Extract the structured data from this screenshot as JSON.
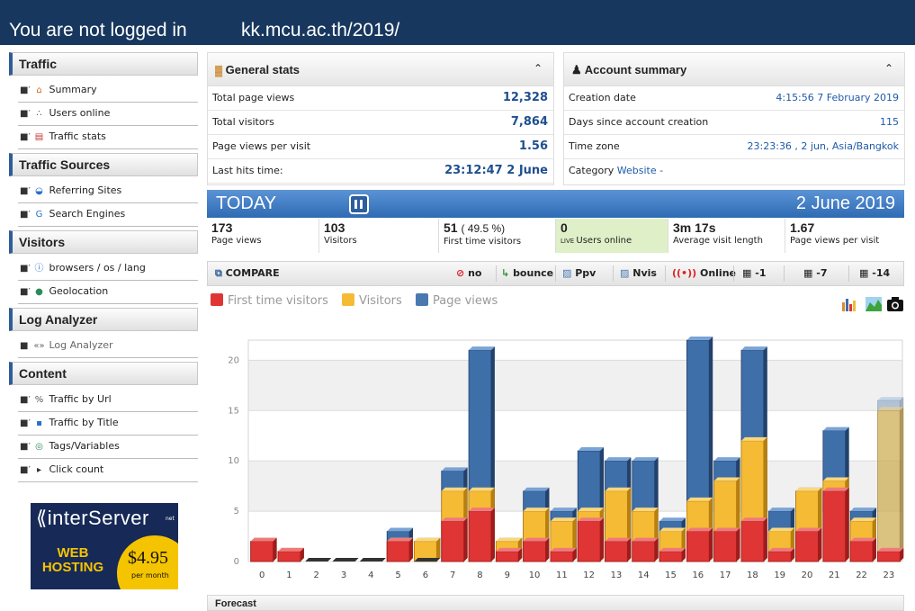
{
  "header": {
    "login_status": "You are not logged in",
    "site": "kk.mcu.ac.th/2019/"
  },
  "sidebar": {
    "sections": [
      {
        "title": "Traffic",
        "items": [
          {
            "label": "Summary",
            "icon": "home-icon",
            "locked": false
          },
          {
            "label": "Users online",
            "icon": "live-icon",
            "locked": false
          },
          {
            "label": "Traffic stats",
            "icon": "calendar-icon",
            "locked": false
          }
        ]
      },
      {
        "title": "Traffic Sources",
        "items": [
          {
            "label": "Referring Sites",
            "icon": "globe-icon",
            "locked": false
          },
          {
            "label": "Search Engines",
            "icon": "google-icon",
            "locked": false
          }
        ]
      },
      {
        "title": "Visitors",
        "items": [
          {
            "label": "browsers / os / lang",
            "icon": "info-icon",
            "locked": false
          },
          {
            "label": "Geolocation",
            "icon": "earth-icon",
            "locked": false
          }
        ]
      },
      {
        "title": "Log Analyzer",
        "items": [
          {
            "label": "Log Analyzer",
            "icon": "code-icon",
            "locked": true
          }
        ]
      },
      {
        "title": "Content",
        "items": [
          {
            "label": "Traffic by Url",
            "icon": "link-icon",
            "locked": false
          },
          {
            "label": "Traffic by Title",
            "icon": "title-icon",
            "locked": false
          },
          {
            "label": "Tags/Variables",
            "icon": "tag-icon",
            "locked": false
          },
          {
            "label": "Click count",
            "icon": "cursor-icon",
            "locked": false
          }
        ]
      }
    ]
  },
  "ad": {
    "brand": "interServer",
    "brand_suffix": "net",
    "line1": "WEB",
    "line2": "HOSTING",
    "price": "$4.95",
    "period": "per month"
  },
  "general_stats": {
    "title": "General stats",
    "rows": [
      {
        "label": "Total page views",
        "value": "12,328"
      },
      {
        "label": "Total visitors",
        "value": "7,864"
      },
      {
        "label": "Page views per visit",
        "value": "1.56"
      },
      {
        "label": "Last hits time:",
        "value": "23:12:47 2 June"
      }
    ]
  },
  "account_summary": {
    "title": "Account summary",
    "rows": [
      {
        "label": "Creation date",
        "value": "4:15:56 7 February 2019"
      },
      {
        "label": "Days since account creation",
        "value": "115"
      },
      {
        "label": "Time zone",
        "value": "23:23:36 , 2 jun, Asia/Bangkok"
      }
    ],
    "category_label": "Category",
    "category_value": "Website -"
  },
  "today": {
    "label": "TODAY",
    "date": "2 June 2019",
    "kpis": [
      {
        "value": "173",
        "label": "Page views"
      },
      {
        "value": "103",
        "label": "Visitors"
      },
      {
        "value": "51",
        "extra": "( 49.5 %)",
        "label": "First time visitors"
      },
      {
        "value": "0",
        "label": "Users online"
      },
      {
        "value": "3m 17s",
        "label": "Average visit length"
      },
      {
        "value": "1.67",
        "label": "Page views per visit"
      }
    ]
  },
  "compare": {
    "title": "COMPARE",
    "options": [
      "no",
      "bounce",
      "Ppv",
      "Nvis",
      "Online",
      "-1",
      "-7",
      "-14"
    ]
  },
  "colors": {
    "first_time": "#e03535",
    "visitors": "#f5bb35",
    "page_views": "#3f6fa8",
    "header_bg": "#17375e",
    "accent": "#2e5d98"
  },
  "chart_data": {
    "type": "bar",
    "categories": [
      "0",
      "1",
      "2",
      "3",
      "4",
      "5",
      "6",
      "7",
      "8",
      "9",
      "10",
      "11",
      "12",
      "13",
      "14",
      "15",
      "16",
      "17",
      "18",
      "19",
      "20",
      "21",
      "22",
      "23"
    ],
    "series": [
      {
        "name": "First time visitors",
        "values": [
          2,
          1,
          0,
          0,
          0,
          2,
          0,
          4,
          5,
          1,
          2,
          1,
          4,
          2,
          2,
          1,
          3,
          3,
          4,
          1,
          3,
          7,
          2,
          1
        ]
      },
      {
        "name": "Visitors",
        "values": [
          2,
          1,
          0,
          0,
          0,
          2,
          2,
          7,
          7,
          2,
          5,
          4,
          5,
          7,
          5,
          3,
          6,
          8,
          12,
          3,
          7,
          8,
          4,
          15
        ]
      },
      {
        "name": "Page views",
        "values": [
          2,
          1,
          0,
          0,
          0,
          3,
          2,
          9,
          21,
          2,
          7,
          5,
          11,
          10,
          10,
          4,
          22,
          10,
          21,
          5,
          7,
          13,
          5,
          16
        ]
      }
    ],
    "ylim": [
      0,
      22
    ],
    "yticks": [
      0,
      5,
      10,
      15,
      20
    ],
    "grid": true,
    "legend": "top-left",
    "current_hour": "23"
  },
  "forecast": {
    "title": "Forecast"
  }
}
